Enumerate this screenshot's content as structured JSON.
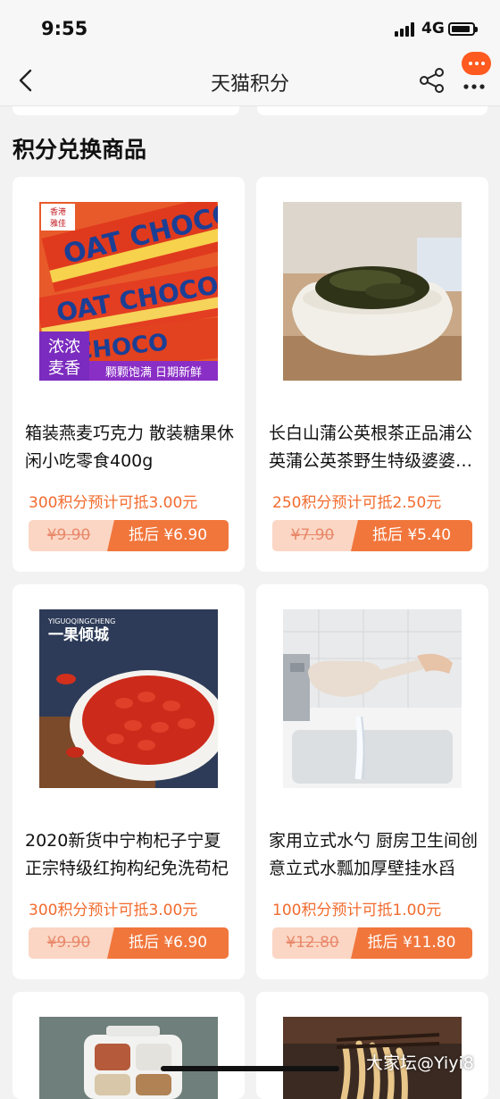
{
  "status": {
    "time": "9:55",
    "network": "4G"
  },
  "nav": {
    "title": "天猫积分"
  },
  "section": {
    "title": "积分兑换商品"
  },
  "products": [
    {
      "name": "箱装燕麦巧克力 散装糖果休闲小吃零食400g",
      "points": "300积分预计可抵3.00元",
      "original_price": "¥9.90",
      "after_price": "抵后 ¥6.90",
      "image_text": {
        "brand": "香港 雅佳",
        "tag": "浓浓麦香",
        "banner": "颗颗饱满 日期新鲜",
        "wrapper": "OAT CHOCO"
      }
    },
    {
      "name": "长白山蒲公英根茶正品浦公英蒲公英茶野生特级婆婆丁茶",
      "points": "250积分预计可抵2.50元",
      "original_price": "¥7.90",
      "after_price": "抵后 ¥5.40"
    },
    {
      "name": "2020新货中宁枸杞子宁夏正宗特级红拘构纪免洗苟杞",
      "points": "300积分预计可抵3.00元",
      "original_price": "¥9.90",
      "after_price": "抵后 ¥6.90",
      "image_text": {
        "brand_en": "YIGUOQINGCHENG",
        "brand": "一果倾城"
      }
    },
    {
      "name": "家用立式水勺 厨房卫生间创意立式水瓢加厚壁挂水舀",
      "points": "100积分预计可抵1.00元",
      "original_price": "¥12.80",
      "after_price": "抵后 ¥11.80"
    }
  ],
  "watermark": "大家坛@Yiyi8"
}
